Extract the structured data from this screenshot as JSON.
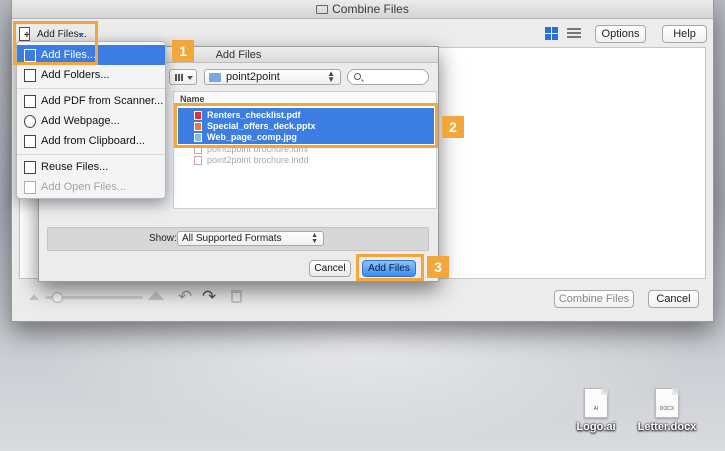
{
  "window": {
    "title": "Combine Files"
  },
  "toolbar": {
    "add_files_label": "Add Files...",
    "options_label": "Options",
    "help_label": "Help"
  },
  "add_files_menu": {
    "items": [
      {
        "label": "Add Files...",
        "icon": "add-file-icon",
        "state": "highlighted"
      },
      {
        "label": "Add Folders...",
        "icon": "add-folder-icon",
        "state": "normal"
      },
      {
        "label": "Add PDF from Scanner...",
        "icon": "scanner-icon",
        "state": "normal"
      },
      {
        "label": "Add Webpage...",
        "icon": "globe-icon",
        "state": "normal"
      },
      {
        "label": "Add from Clipboard...",
        "icon": "clipboard-icon",
        "state": "normal"
      },
      {
        "label": "Reuse Files...",
        "icon": "reuse-files-icon",
        "state": "normal"
      },
      {
        "label": "Add Open Files...",
        "icon": "open-files-icon",
        "state": "disabled"
      }
    ]
  },
  "dialog": {
    "title": "Add Files",
    "location": "point2point",
    "search_placeholder": "",
    "column_header": "Name",
    "files": [
      {
        "name": "Renters_checklist.pdf",
        "selected": true
      },
      {
        "name": "Special_offers_deck.pptx",
        "selected": true
      },
      {
        "name": "Web_page_comp.jpg",
        "selected": true
      },
      {
        "name": "point2point brochure.idml",
        "selected": false
      },
      {
        "name": "point2point brochure.indd",
        "selected": false
      }
    ],
    "show_label": "Show:",
    "show_value": "All Supported Formats",
    "cancel_label": "Cancel",
    "confirm_label": "Add Files"
  },
  "footer": {
    "combine_label": "Combine Files",
    "cancel_label": "Cancel"
  },
  "callouts": [
    "1",
    "2",
    "3"
  ],
  "desktop_icons": [
    {
      "name": "Logo.ai",
      "badge": "AI"
    },
    {
      "name": "Letter.docx",
      "badge": "DOCX"
    }
  ],
  "colors": {
    "accent": "#3b7de0",
    "callout": "#f3a73a",
    "primary_button": "#3a8df0"
  }
}
